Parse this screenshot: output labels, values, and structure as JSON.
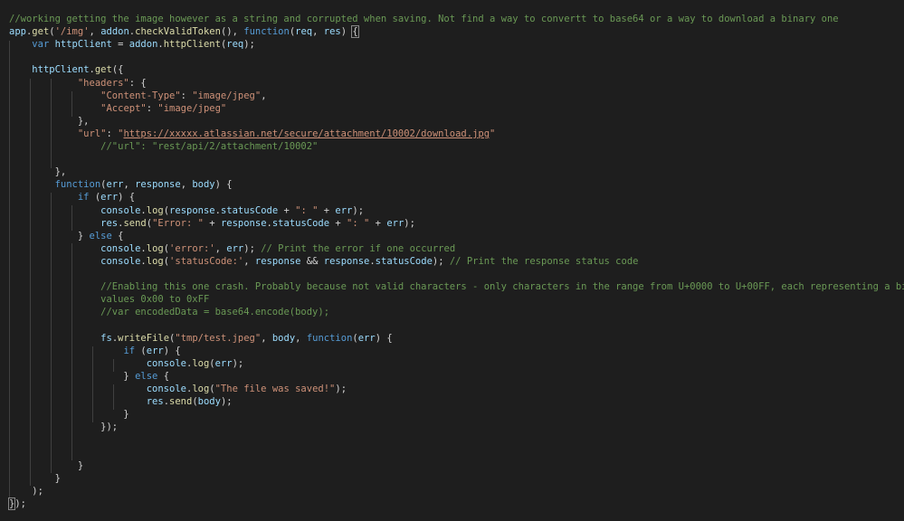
{
  "editor": {
    "language": "javascript",
    "colors": {
      "background": "#1e1e1e",
      "comment": "#6a9955",
      "keyword": "#569cd6",
      "string": "#ce9178",
      "variable": "#9cdcfe",
      "function": "#dcdcaa",
      "number": "#b5cea8",
      "text": "#d4d4d4",
      "indent_guide": "#404040"
    },
    "lines": [
      {
        "tokens": [
          {
            "t": "comment",
            "v": "//working getting the image however as a string and corrupted when saving. Not find a way to convertt to base64 or a way to download a binary one"
          }
        ]
      },
      {
        "tokens": [
          {
            "t": "var",
            "v": "app"
          },
          {
            "t": "punct",
            "v": "."
          },
          {
            "t": "func",
            "v": "get"
          },
          {
            "t": "punct",
            "v": "("
          },
          {
            "t": "string",
            "v": "'/img'"
          },
          {
            "t": "punct",
            "v": ", "
          },
          {
            "t": "var",
            "v": "addon"
          },
          {
            "t": "punct",
            "v": "."
          },
          {
            "t": "func",
            "v": "checkValidToken"
          },
          {
            "t": "punct",
            "v": "(), "
          },
          {
            "t": "keyword",
            "v": "function"
          },
          {
            "t": "punct",
            "v": "("
          },
          {
            "t": "var",
            "v": "req"
          },
          {
            "t": "punct",
            "v": ", "
          },
          {
            "t": "var",
            "v": "res"
          },
          {
            "t": "punct",
            "v": ") "
          },
          {
            "t": "bracket",
            "v": "{"
          }
        ]
      },
      {
        "tokens": [
          {
            "t": "punct",
            "v": "    "
          },
          {
            "t": "keyword",
            "v": "var"
          },
          {
            "t": "punct",
            "v": " "
          },
          {
            "t": "var",
            "v": "httpClient"
          },
          {
            "t": "punct",
            "v": " = "
          },
          {
            "t": "var",
            "v": "addon"
          },
          {
            "t": "punct",
            "v": "."
          },
          {
            "t": "func",
            "v": "httpClient"
          },
          {
            "t": "punct",
            "v": "("
          },
          {
            "t": "var",
            "v": "req"
          },
          {
            "t": "punct",
            "v": ");"
          }
        ]
      },
      {
        "tokens": []
      },
      {
        "tokens": [
          {
            "t": "punct",
            "v": "    "
          },
          {
            "t": "var",
            "v": "httpClient"
          },
          {
            "t": "punct",
            "v": "."
          },
          {
            "t": "func",
            "v": "get"
          },
          {
            "t": "punct",
            "v": "({"
          }
        ]
      },
      {
        "tokens": [
          {
            "t": "punct",
            "v": "            "
          },
          {
            "t": "string",
            "v": "\"headers\""
          },
          {
            "t": "punct",
            "v": ": {"
          }
        ]
      },
      {
        "tokens": [
          {
            "t": "punct",
            "v": "                "
          },
          {
            "t": "string",
            "v": "\"Content-Type\""
          },
          {
            "t": "punct",
            "v": ": "
          },
          {
            "t": "string",
            "v": "\"image/jpeg\""
          },
          {
            "t": "punct",
            "v": ","
          }
        ]
      },
      {
        "tokens": [
          {
            "t": "punct",
            "v": "                "
          },
          {
            "t": "string",
            "v": "\"Accept\""
          },
          {
            "t": "punct",
            "v": ": "
          },
          {
            "t": "string",
            "v": "\"image/jpeg\""
          }
        ]
      },
      {
        "tokens": [
          {
            "t": "punct",
            "v": "            },"
          }
        ]
      },
      {
        "tokens": [
          {
            "t": "punct",
            "v": "            "
          },
          {
            "t": "string",
            "v": "\"url\""
          },
          {
            "t": "punct",
            "v": ": "
          },
          {
            "t": "string",
            "v": "\""
          },
          {
            "t": "link",
            "v": "https://xxxxx.atlassian.net/secure/attachment/10002/download.jpg"
          },
          {
            "t": "string",
            "v": "\""
          }
        ]
      },
      {
        "tokens": [
          {
            "t": "punct",
            "v": "                "
          },
          {
            "t": "comment",
            "v": "//\"url\": \"rest/api/2/attachment/10002\""
          }
        ]
      },
      {
        "tokens": []
      },
      {
        "tokens": [
          {
            "t": "punct",
            "v": "        },"
          }
        ]
      },
      {
        "tokens": [
          {
            "t": "punct",
            "v": "        "
          },
          {
            "t": "keyword",
            "v": "function"
          },
          {
            "t": "punct",
            "v": "("
          },
          {
            "t": "var",
            "v": "err"
          },
          {
            "t": "punct",
            "v": ", "
          },
          {
            "t": "var",
            "v": "response"
          },
          {
            "t": "punct",
            "v": ", "
          },
          {
            "t": "var",
            "v": "body"
          },
          {
            "t": "punct",
            "v": ") {"
          }
        ]
      },
      {
        "tokens": [
          {
            "t": "punct",
            "v": "            "
          },
          {
            "t": "keyword",
            "v": "if"
          },
          {
            "t": "punct",
            "v": " ("
          },
          {
            "t": "var",
            "v": "err"
          },
          {
            "t": "punct",
            "v": ") {"
          }
        ]
      },
      {
        "tokens": [
          {
            "t": "punct",
            "v": "                "
          },
          {
            "t": "var",
            "v": "console"
          },
          {
            "t": "punct",
            "v": "."
          },
          {
            "t": "func",
            "v": "log"
          },
          {
            "t": "punct",
            "v": "("
          },
          {
            "t": "var",
            "v": "response"
          },
          {
            "t": "punct",
            "v": "."
          },
          {
            "t": "var",
            "v": "statusCode"
          },
          {
            "t": "punct",
            "v": " + "
          },
          {
            "t": "string",
            "v": "\": \""
          },
          {
            "t": "punct",
            "v": " + "
          },
          {
            "t": "var",
            "v": "err"
          },
          {
            "t": "punct",
            "v": ");"
          }
        ]
      },
      {
        "tokens": [
          {
            "t": "punct",
            "v": "                "
          },
          {
            "t": "var",
            "v": "res"
          },
          {
            "t": "punct",
            "v": "."
          },
          {
            "t": "func",
            "v": "send"
          },
          {
            "t": "punct",
            "v": "("
          },
          {
            "t": "string",
            "v": "\"Error: \""
          },
          {
            "t": "punct",
            "v": " + "
          },
          {
            "t": "var",
            "v": "response"
          },
          {
            "t": "punct",
            "v": "."
          },
          {
            "t": "var",
            "v": "statusCode"
          },
          {
            "t": "punct",
            "v": " + "
          },
          {
            "t": "string",
            "v": "\": \""
          },
          {
            "t": "punct",
            "v": " + "
          },
          {
            "t": "var",
            "v": "err"
          },
          {
            "t": "punct",
            "v": ");"
          }
        ]
      },
      {
        "tokens": [
          {
            "t": "punct",
            "v": "            } "
          },
          {
            "t": "keyword",
            "v": "else"
          },
          {
            "t": "punct",
            "v": " {"
          }
        ]
      },
      {
        "tokens": [
          {
            "t": "punct",
            "v": "                "
          },
          {
            "t": "var",
            "v": "console"
          },
          {
            "t": "punct",
            "v": "."
          },
          {
            "t": "func",
            "v": "log"
          },
          {
            "t": "punct",
            "v": "("
          },
          {
            "t": "string",
            "v": "'error:'"
          },
          {
            "t": "punct",
            "v": ", "
          },
          {
            "t": "var",
            "v": "err"
          },
          {
            "t": "punct",
            "v": "); "
          },
          {
            "t": "comment",
            "v": "// Print the error if one occurred"
          }
        ]
      },
      {
        "tokens": [
          {
            "t": "punct",
            "v": "                "
          },
          {
            "t": "var",
            "v": "console"
          },
          {
            "t": "punct",
            "v": "."
          },
          {
            "t": "func",
            "v": "log"
          },
          {
            "t": "punct",
            "v": "("
          },
          {
            "t": "string",
            "v": "'statusCode:'"
          },
          {
            "t": "punct",
            "v": ", "
          },
          {
            "t": "var",
            "v": "response"
          },
          {
            "t": "punct",
            "v": " && "
          },
          {
            "t": "var",
            "v": "response"
          },
          {
            "t": "punct",
            "v": "."
          },
          {
            "t": "var",
            "v": "statusCode"
          },
          {
            "t": "punct",
            "v": "); "
          },
          {
            "t": "comment",
            "v": "// Print the response status code"
          }
        ]
      },
      {
        "tokens": []
      },
      {
        "tokens": [
          {
            "t": "punct",
            "v": "                "
          },
          {
            "t": "comment",
            "v": "//Enabling this one crash. Probably because not valid characters - only characters in the range from U+0000 to U+00FF, each representing a binary byte with"
          }
        ]
      },
      {
        "tokens": [
          {
            "t": "punct",
            "v": "                "
          },
          {
            "t": "comment",
            "v": "values 0x00 to 0xFF"
          }
        ]
      },
      {
        "tokens": [
          {
            "t": "punct",
            "v": "                "
          },
          {
            "t": "comment",
            "v": "//var encodedData = base64.encode(body);"
          }
        ]
      },
      {
        "tokens": []
      },
      {
        "tokens": [
          {
            "t": "punct",
            "v": "                "
          },
          {
            "t": "var",
            "v": "fs"
          },
          {
            "t": "punct",
            "v": "."
          },
          {
            "t": "func",
            "v": "writeFile"
          },
          {
            "t": "punct",
            "v": "("
          },
          {
            "t": "string",
            "v": "\"tmp/test.jpeg\""
          },
          {
            "t": "punct",
            "v": ", "
          },
          {
            "t": "var",
            "v": "body"
          },
          {
            "t": "punct",
            "v": ", "
          },
          {
            "t": "keyword",
            "v": "function"
          },
          {
            "t": "punct",
            "v": "("
          },
          {
            "t": "var",
            "v": "err"
          },
          {
            "t": "punct",
            "v": ") {"
          }
        ]
      },
      {
        "tokens": [
          {
            "t": "punct",
            "v": "                    "
          },
          {
            "t": "keyword",
            "v": "if"
          },
          {
            "t": "punct",
            "v": " ("
          },
          {
            "t": "var",
            "v": "err"
          },
          {
            "t": "punct",
            "v": ") {"
          }
        ]
      },
      {
        "tokens": [
          {
            "t": "punct",
            "v": "                        "
          },
          {
            "t": "var",
            "v": "console"
          },
          {
            "t": "punct",
            "v": "."
          },
          {
            "t": "func",
            "v": "log"
          },
          {
            "t": "punct",
            "v": "("
          },
          {
            "t": "var",
            "v": "err"
          },
          {
            "t": "punct",
            "v": ");"
          }
        ]
      },
      {
        "tokens": [
          {
            "t": "punct",
            "v": "                    } "
          },
          {
            "t": "keyword",
            "v": "else"
          },
          {
            "t": "punct",
            "v": " {"
          }
        ]
      },
      {
        "tokens": [
          {
            "t": "punct",
            "v": "                        "
          },
          {
            "t": "var",
            "v": "console"
          },
          {
            "t": "punct",
            "v": "."
          },
          {
            "t": "func",
            "v": "log"
          },
          {
            "t": "punct",
            "v": "("
          },
          {
            "t": "string",
            "v": "\"The file was saved!\""
          },
          {
            "t": "punct",
            "v": ");"
          }
        ]
      },
      {
        "tokens": [
          {
            "t": "punct",
            "v": "                        "
          },
          {
            "t": "var",
            "v": "res"
          },
          {
            "t": "punct",
            "v": "."
          },
          {
            "t": "func",
            "v": "send"
          },
          {
            "t": "punct",
            "v": "("
          },
          {
            "t": "var",
            "v": "body"
          },
          {
            "t": "punct",
            "v": ");"
          }
        ]
      },
      {
        "tokens": [
          {
            "t": "punct",
            "v": "                    }"
          }
        ]
      },
      {
        "tokens": [
          {
            "t": "punct",
            "v": "                });"
          }
        ]
      },
      {
        "tokens": []
      },
      {
        "tokens": []
      },
      {
        "tokens": [
          {
            "t": "punct",
            "v": "            }"
          }
        ]
      },
      {
        "tokens": [
          {
            "t": "punct",
            "v": "        }"
          }
        ]
      },
      {
        "tokens": [
          {
            "t": "punct",
            "v": "    );"
          }
        ]
      },
      {
        "tokens": [
          {
            "t": "bracket",
            "v": "}"
          },
          {
            "t": "punct",
            "v": ");"
          }
        ]
      }
    ]
  }
}
